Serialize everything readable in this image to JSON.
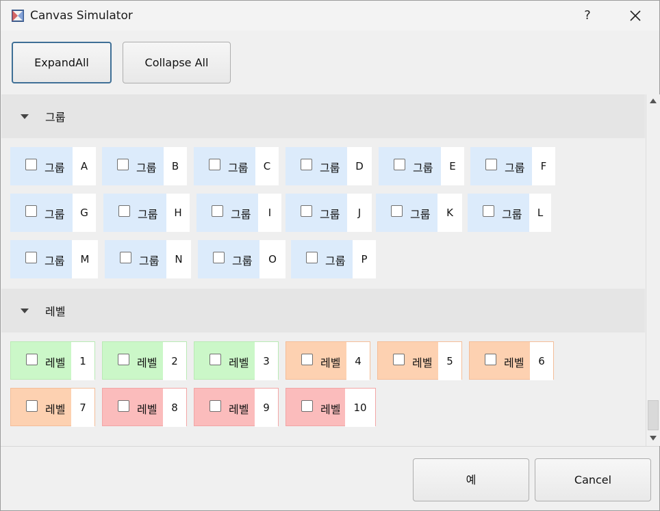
{
  "window": {
    "title": "Canvas Simulator",
    "help_label": "?"
  },
  "toolbar": {
    "expand_label": "ExpandAll",
    "collapse_label": "Collapse All"
  },
  "groups_section": {
    "title": "그룹",
    "items": [
      {
        "label": "그룹",
        "tag": "A"
      },
      {
        "label": "그룹",
        "tag": "B"
      },
      {
        "label": "그룹",
        "tag": "C"
      },
      {
        "label": "그룹",
        "tag": "D"
      },
      {
        "label": "그룹",
        "tag": "E"
      },
      {
        "label": "그룹",
        "tag": "F"
      },
      {
        "label": "그룹",
        "tag": "G"
      },
      {
        "label": "그룹",
        "tag": "H"
      },
      {
        "label": "그룹",
        "tag": "I"
      },
      {
        "label": "그룹",
        "tag": "J"
      },
      {
        "label": "그룹",
        "tag": "K"
      },
      {
        "label": "그룹",
        "tag": "L"
      },
      {
        "label": "그룹",
        "tag": "M"
      },
      {
        "label": "그룹",
        "tag": "N"
      },
      {
        "label": "그룹",
        "tag": "O"
      },
      {
        "label": "그룹",
        "tag": "P"
      }
    ]
  },
  "levels_section": {
    "title": "레벨",
    "items": [
      {
        "label": "레벨",
        "tag": "1"
      },
      {
        "label": "레벨",
        "tag": "2"
      },
      {
        "label": "레벨",
        "tag": "3"
      },
      {
        "label": "레벨",
        "tag": "4"
      },
      {
        "label": "레벨",
        "tag": "5"
      },
      {
        "label": "레벨",
        "tag": "6"
      },
      {
        "label": "레벨",
        "tag": "7"
      },
      {
        "label": "레벨",
        "tag": "8"
      },
      {
        "label": "레벨",
        "tag": "9"
      },
      {
        "label": "레벨",
        "tag": "10"
      }
    ]
  },
  "colors": {
    "group_bg": "#dcebfb",
    "level_green": "#cbf7c8",
    "level_orange": "#fdd1b1",
    "level_red": "#fbbcbc"
  },
  "footer": {
    "ok_label": "예",
    "cancel_label": "Cancel"
  }
}
